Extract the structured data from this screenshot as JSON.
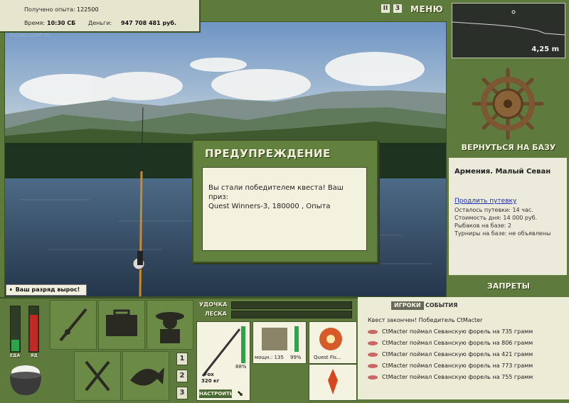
{
  "hud": {
    "xp_label": "Получено опыта:",
    "xp_value": "122500",
    "time_label": "Время:",
    "time_value": "10:30 СБ",
    "money_label": "Деньги:",
    "money_value": "947 708 481 руб.",
    "watermark": "INSTALLSOFT.RU"
  },
  "topbar": {
    "pause_label": "II",
    "speed_label": "3",
    "menu_label": "МЕНЮ"
  },
  "depth": {
    "value": "4,25 m"
  },
  "side": {
    "return_label": "ВЕРНУТЬСЯ НА БАЗУ",
    "location_title": "Армения. Малый Севан",
    "extend_link": "Продлить путевку",
    "remaining": "Осталось путевки: 14 час.",
    "day_cost": "Стоимость дня: 14 000 руб.",
    "anglers": "Рыбаков на базе: 2",
    "tournaments": "Турниры на базе: не объявлены",
    "bans_label": "ЗАПРЕТЫ"
  },
  "dialog": {
    "title": "ПРЕДУПРЕЖДЕНИЕ",
    "line1": "Вы стали победителем квеста! Ваш приз:",
    "line2": "Quest Winners-3, 180000 , Опыта"
  },
  "notification": {
    "text": "Ваш разряд вырос!"
  },
  "meters": {
    "food_label": "ЕДА",
    "poison_label": "ЯД",
    "food_level": 0.25,
    "poison_level": 0.82
  },
  "tackle": {
    "rod_label": "УДОЧКА",
    "line_label": "ЛЕСКА",
    "rod_name": "Fox",
    "rod_weight": "320 кг",
    "rod_percent": "88%",
    "reel_stats": "мощн.: 135",
    "reel_percent": "99%",
    "line_name": "Quest Fis...",
    "setup_label": "НАСТРОИТЬ"
  },
  "pages": [
    "1",
    "2",
    "3"
  ],
  "events": {
    "tab_players": "ИГРОКИ",
    "tab_events": "СОБЫТИЯ",
    "header": "Квест закончен! Победитель CtMacter",
    "items": [
      "CtMacter поймал Севанскую форель на 735 грамм",
      "CtMacter поймал Севанскую форель на 806 грамм",
      "CtMacter поймал Севанскую форель на 421 грамм",
      "CtMacter поймал Севанскую форель на 773 грамм",
      "CtMacter поймал Севанскую форель на 755 грамм"
    ]
  },
  "colors": {
    "panel_green": "#5e7a3c",
    "cream": "#ecebd6",
    "link_blue": "#1a2fb5"
  }
}
